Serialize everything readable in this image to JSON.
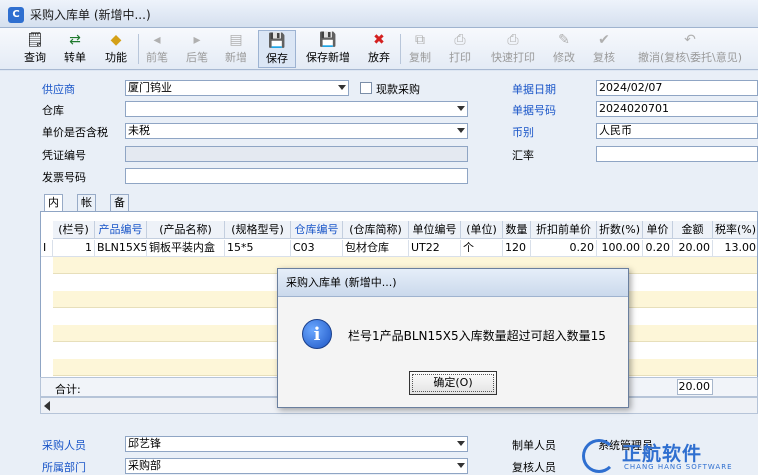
{
  "window": {
    "title": "采购入库单 (新增中...)",
    "app_icon": "C"
  },
  "toolbar": {
    "buttons": [
      {
        "label": "查询",
        "icon": "query-icon",
        "glyph": "🗒",
        "enabled": true
      },
      {
        "label": "转单",
        "icon": "transfer-icon",
        "glyph": "⇄",
        "enabled": true
      },
      {
        "label": "功能",
        "icon": "function-icon",
        "glyph": "◆",
        "enabled": true
      },
      {
        "label": "前笔",
        "icon": "prev-icon",
        "glyph": "◂",
        "enabled": false
      },
      {
        "label": "后笔",
        "icon": "next-icon",
        "glyph": "▸",
        "enabled": false
      },
      {
        "label": "新增",
        "icon": "new-icon",
        "glyph": "▤",
        "enabled": false
      },
      {
        "label": "保存",
        "icon": "save-icon",
        "glyph": "💾",
        "enabled": true
      },
      {
        "label": "保存新增",
        "icon": "save-new-icon",
        "glyph": "💾",
        "enabled": true
      },
      {
        "label": "放弃",
        "icon": "discard-icon",
        "glyph": "✖",
        "enabled": true
      },
      {
        "label": "复制",
        "icon": "copy-icon",
        "glyph": "⧉",
        "enabled": false
      },
      {
        "label": "打印",
        "icon": "print-icon",
        "glyph": "⎙",
        "enabled": false
      },
      {
        "label": "快速打印",
        "icon": "quick-print-icon",
        "glyph": "⎙",
        "enabled": false
      },
      {
        "label": "修改",
        "icon": "edit-icon",
        "glyph": "✎",
        "enabled": false
      },
      {
        "label": "复核",
        "icon": "review-icon",
        "glyph": "✔",
        "enabled": false
      },
      {
        "label": "撤消(复核\\委托\\意见)",
        "icon": "undo-icon",
        "glyph": "↶",
        "enabled": false
      }
    ]
  },
  "form": {
    "supplier_label": "供应商",
    "supplier_value": "厦门钨业",
    "cash_purchase_label": "现款采购",
    "warehouse_label": "仓库",
    "warehouse_value": "",
    "tax_label": "单价是否含税",
    "tax_value": "未税",
    "voucher_label": "凭证编号",
    "voucher_value": "",
    "invoice_label": "发票号码",
    "invoice_value": "",
    "date_label": "单据日期",
    "date_value": "2024/02/07",
    "docno_label": "单据号码",
    "docno_value": "2024020701",
    "currency_label": "币别",
    "currency_value": "人民币",
    "rate_label": "汇率",
    "rate_value": ""
  },
  "tabs": [
    "内容",
    "帐款",
    "备注"
  ],
  "grid": {
    "headers": [
      "(栏号)",
      "产品编号",
      "(产品名称)",
      "(规格型号)",
      "仓库编号",
      "(仓库简称)",
      "单位编号",
      "(单位)",
      "数量",
      "折扣前单价",
      "折数(%)",
      "单价",
      "金额",
      "税率(%)"
    ],
    "row_marker": "I",
    "rows": [
      [
        "1",
        "BLN15X5",
        "铜板平装内盒",
        "15*5",
        "C03",
        "包材仓库",
        "UT22",
        "个",
        "120",
        "0.20",
        "100.00",
        "0.20",
        "20.00",
        "13.00"
      ]
    ],
    "sum_label": "合计:",
    "sum_amount": "20.00"
  },
  "bottom": {
    "buyer_label": "采购人员",
    "buyer_value": "邱艺锋",
    "dept_label": "所属部门",
    "dept_value": "采购部",
    "maker_label": "制单人员",
    "maker_value": "系统管理员",
    "reviewer_label": "复核人员"
  },
  "dialog": {
    "title": "采购入库单 (新增中...)",
    "message": "栏号1产品BLN15X5入库数量超过可超入数量15",
    "ok_label": "确定(O)"
  },
  "watermark": {
    "text": "正航软件",
    "sub": "CHANG HANG SOFTWARE"
  },
  "colors": {
    "accent": "#1a56c8",
    "row_highlight": "#fdf6d8"
  }
}
